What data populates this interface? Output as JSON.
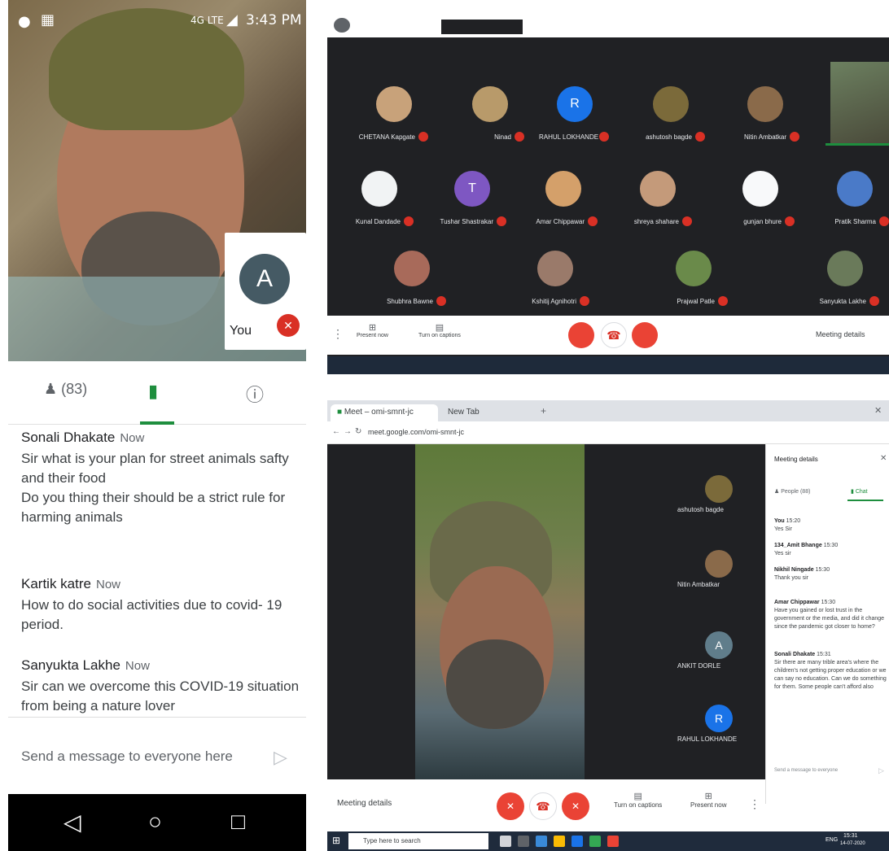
{
  "phone": {
    "status": {
      "time": "3:43 PM",
      "network": "4G LTE"
    },
    "self_tile": {
      "avatar_letter": "A",
      "label": "You"
    },
    "tabs": {
      "people_count": "(83)"
    },
    "chat": [
      {
        "name": "Sonali Dhakate",
        "time": "Now",
        "lines": [
          "Sir what is your plan for street animals safty and their food",
          "Do you thing their should be a strict rule for harming animals"
        ]
      },
      {
        "name": "Kartik katre",
        "time": "Now",
        "lines": [
          "How to do social activities due to covid- 19 period."
        ]
      },
      {
        "name": "Sanyukta Lakhe",
        "time": "Now",
        "lines": [
          "Sir can we overcome this COVID-19 situation from being a nature lover"
        ]
      }
    ],
    "input_placeholder": "Send a message to everyone here"
  },
  "desktop_grid": {
    "tiles_row1": [
      {
        "name": "CHETANA Kapgate",
        "color": "#c8a27a"
      },
      {
        "name": "Ninad",
        "color": "#b89a6a"
      },
      {
        "name": "RAHUL LOKHANDE",
        "letter": "R",
        "color": "#1a73e8"
      },
      {
        "name": "ashutosh bagde",
        "color": "#7b6a3a"
      },
      {
        "name": "Nitin Ambatkar",
        "color": "#8a6a4a"
      }
    ],
    "tiles_row2": [
      {
        "name": "Kunal Dandade",
        "color": "#f1f3f4"
      },
      {
        "name": "Tushar Shastrakar",
        "letter": "T",
        "color": "#7e57c2"
      },
      {
        "name": "Amar Chippawar",
        "color": "#d4a06a"
      },
      {
        "name": "shreya shahare",
        "color": "#c49a7a"
      },
      {
        "name": "gunjan bhure",
        "color": "#f8f9fa"
      },
      {
        "name": "Pratik Sharma",
        "color": "#4a7ac8"
      }
    ],
    "tiles_row3": [
      {
        "name": "Shubhra Bawne",
        "color": "#a86a5a"
      },
      {
        "name": "Kshitij Agnihotri",
        "color": "#9a7a6a"
      },
      {
        "name": "Prajwal Patle",
        "color": "#6a8a4a"
      },
      {
        "name": "Sanyukta Lakhe",
        "color": "#6a7a5a"
      }
    ],
    "bar": {
      "present": "Present now",
      "captions": "Turn on captions",
      "details": "Meeting details"
    }
  },
  "desktop_meet": {
    "tabs": [
      "Meet – omi-smnt-jc",
      "New Tab"
    ],
    "url": "meet.google.com/omi-smnt-jc",
    "sidebar": [
      {
        "name": "ashutosh bagde",
        "color": "#7b6a3a"
      },
      {
        "name": "Nitin Ambatkar",
        "color": "#8a6a4a"
      },
      {
        "name": "ANKIT DORLE",
        "letter": "A",
        "color": "#607d8b"
      },
      {
        "name": "RAHUL LOKHANDE",
        "letter": "R",
        "color": "#1a73e8"
      }
    ],
    "panel": {
      "title": "Meeting details",
      "people": "People (88)",
      "chat": "Chat",
      "messages": [
        {
          "name": "You",
          "time": "15:20",
          "text": "Yes Sir"
        },
        {
          "name": "134_Amit Bhange",
          "time": "15:30",
          "text": "Yes sir"
        },
        {
          "name": "Nikhil Ningade",
          "time": "15:30",
          "text": "Thank you sir"
        },
        {
          "name": "Amar Chippawar",
          "time": "15:30",
          "text": "Have you gained or lost trust in the government or the media, and did it change since the pandemic got closer to home?"
        },
        {
          "name": "Sonali Dhakate",
          "time": "15:31",
          "text": "Sir there are many trible area's where the children's not getting proper education or we can say no education. Can we do something for them. Some people can't afford also"
        }
      ],
      "input": "Send a message to everyone"
    },
    "bar": {
      "details": "Meeting details",
      "captions": "Turn on captions",
      "present": "Present now"
    },
    "taskbar": {
      "search": "Type here to search",
      "time": "15:31",
      "date": "14-07-2020",
      "lang": "ENG"
    }
  }
}
